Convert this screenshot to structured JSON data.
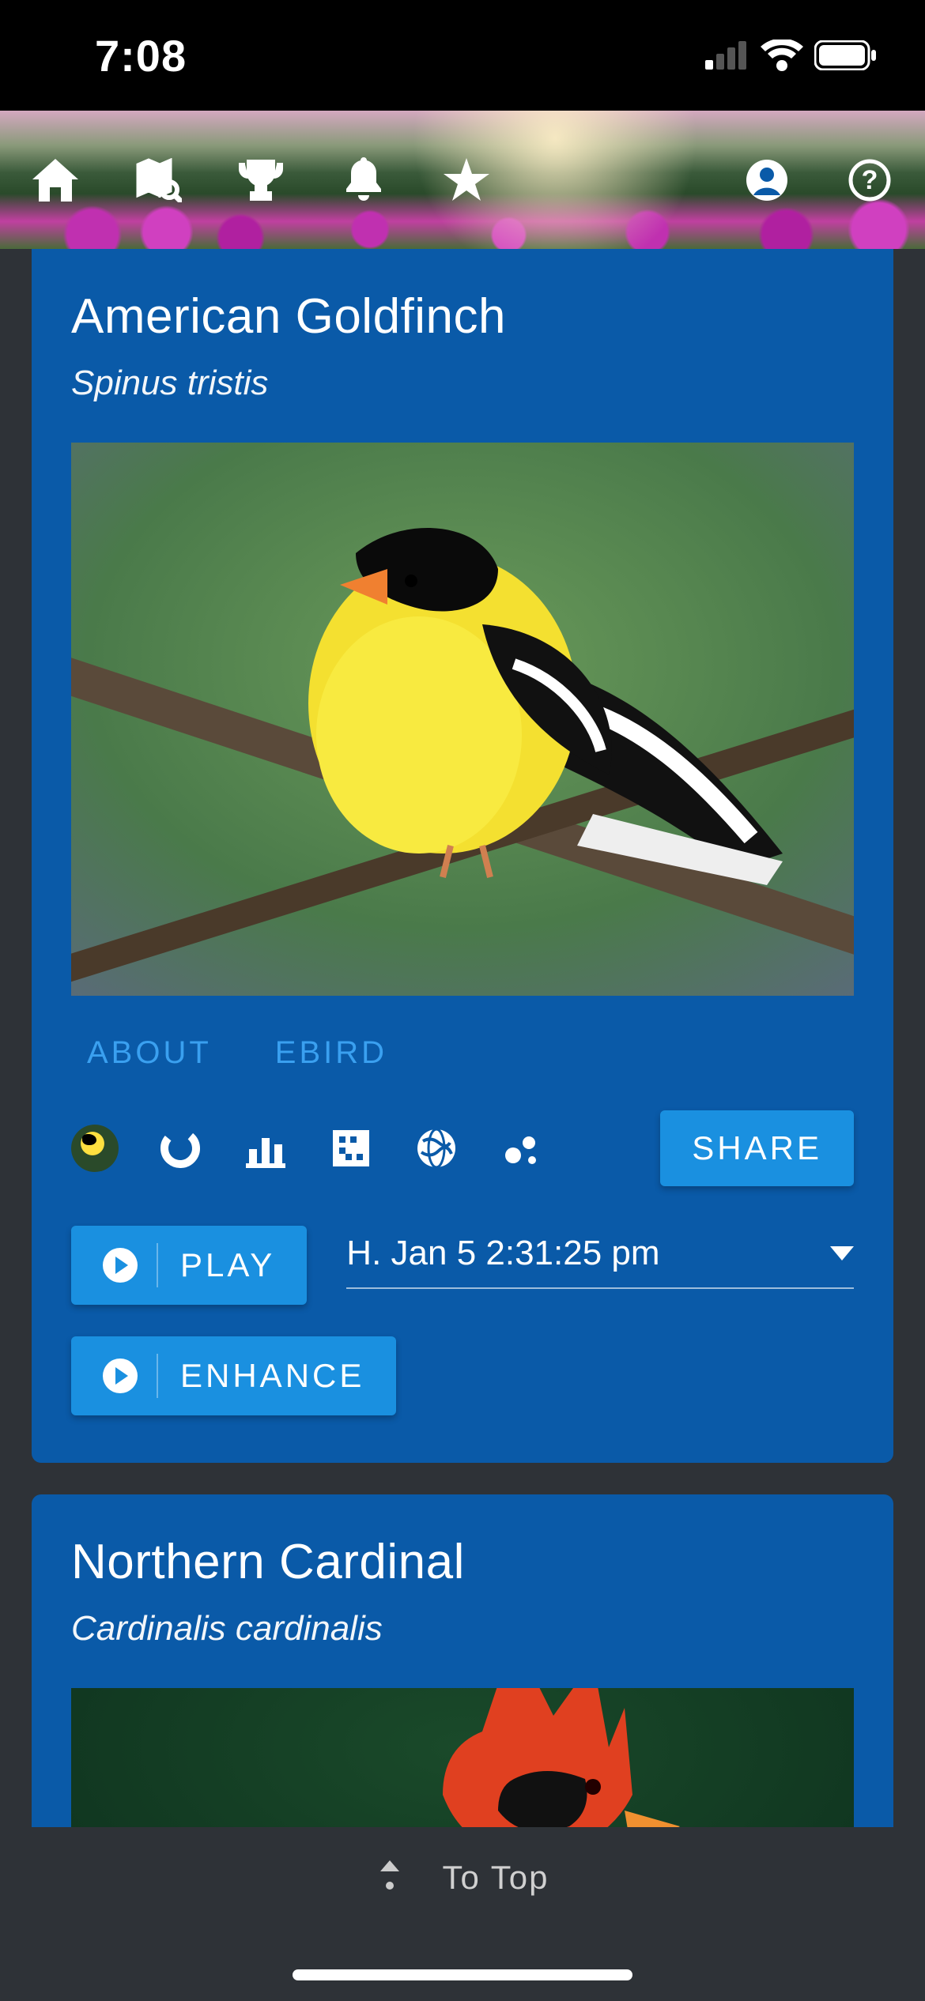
{
  "status": {
    "time": "7:08"
  },
  "nav": {
    "icons": [
      "home-icon",
      "map-search-icon",
      "trophy-icon",
      "bell-icon",
      "star-icon",
      "account-icon",
      "help-icon"
    ]
  },
  "cards": [
    {
      "common_name": "American Goldfinch",
      "scientific_name": "Spinus tristis",
      "tabs": {
        "about": "ABOUT",
        "ebird": "EBIRD"
      },
      "share_label": "SHARE",
      "play_label": "PLAY",
      "enhance_label": "ENHANCE",
      "recording_selected": "H. Jan 5 2:31:25 pm",
      "tool_icons": [
        "species-thumb",
        "ring-chart-icon",
        "bar-chart-icon",
        "grid-icon",
        "globe-icon",
        "scatter-icon"
      ]
    },
    {
      "common_name": "Northern Cardinal",
      "scientific_name": "Cardinalis cardinalis"
    }
  ],
  "footer": {
    "to_top": "To Top"
  }
}
